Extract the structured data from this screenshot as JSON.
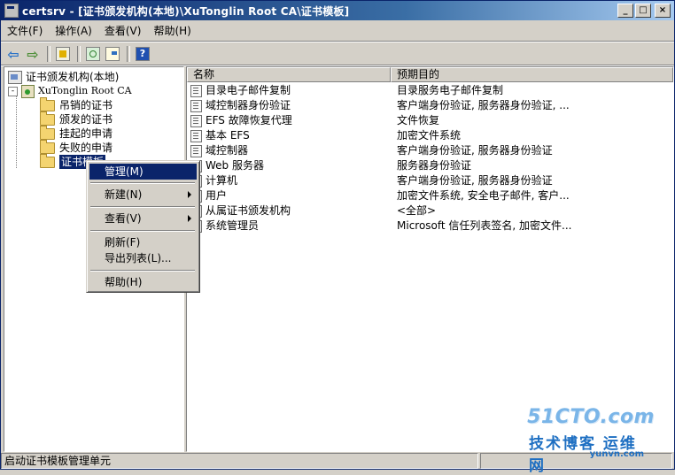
{
  "window": {
    "title": "certsrv - [证书颁发机构(本地)\\XuTonglin Root CA\\证书模板]",
    "minimize_glyph": "_",
    "maximize_glyph": "□",
    "close_glyph": "×"
  },
  "menubar": [
    "文件(F)",
    "操作(A)",
    "查看(V)",
    "帮助(H)"
  ],
  "toolbar": {
    "back_glyph": "⇦",
    "forward_glyph": "⇨",
    "help_glyph": "?"
  },
  "tree": {
    "root": "证书颁发机构(本地)",
    "ca": "XuTonglin Root CA",
    "ca_expander": "-",
    "folders": [
      "吊销的证书",
      "颁发的证书",
      "挂起的申请",
      "失败的申请",
      "证书模板"
    ]
  },
  "list": {
    "columns": [
      "名称",
      "预期目的"
    ],
    "rows": [
      {
        "name": "目录电子邮件复制",
        "purpose": "目录服务电子邮件复制"
      },
      {
        "name": "域控制器身份验证",
        "purpose": "客户端身份验证, 服务器身份验证, ..."
      },
      {
        "name": "EFS 故障恢复代理",
        "purpose": "文件恢复"
      },
      {
        "name": "基本 EFS",
        "purpose": "加密文件系统"
      },
      {
        "name": "域控制器",
        "purpose": "客户端身份验证, 服务器身份验证"
      },
      {
        "name": "Web 服务器",
        "purpose": "服务器身份验证"
      },
      {
        "name": "计算机",
        "purpose": "客户端身份验证, 服务器身份验证"
      },
      {
        "name": "用户",
        "purpose": "加密文件系统, 安全电子邮件, 客户..."
      },
      {
        "name": "从属证书颁发机构",
        "purpose": "<全部>"
      },
      {
        "name": "系统管理员",
        "purpose": "Microsoft 信任列表签名, 加密文件..."
      }
    ]
  },
  "context_menu": {
    "manage": "管理(M)",
    "new": "新建(N)",
    "view": "查看(V)",
    "refresh": "刷新(F)",
    "export": "导出列表(L)...",
    "help": "帮助(H)"
  },
  "status": {
    "text": "启动证书模板管理单元"
  },
  "watermark": {
    "line1": "51CTO.com",
    "line2": "技术博客 运维网",
    "line3": "yunvn.com"
  }
}
